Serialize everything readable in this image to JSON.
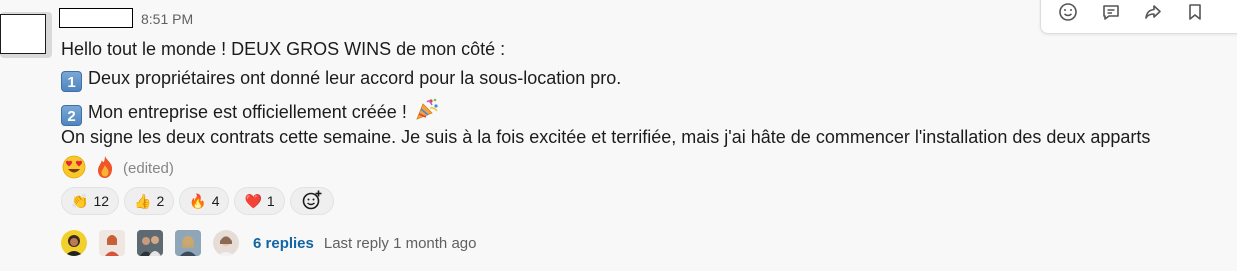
{
  "message": {
    "time": "8:51 PM",
    "lines": {
      "intro": "Hello tout le monde ! DEUX GROS WINS de mon côté :",
      "item1_num": "1",
      "item1": "Deux propriétaires ont donné leur accord pour la sous-location pro.",
      "item2_num": "2",
      "item2": "Mon entreprise est officiellement créée !",
      "body": "On signe les deux contrats cette semaine. Je suis à la fois excitée et terrifiée, mais j'ai hâte de commencer l'installation des deux apparts"
    },
    "edited": "(edited)",
    "emoji": [
      "heart-eyes",
      "fire",
      "party-popper"
    ]
  },
  "actions": {
    "icons": [
      "emoji-reaction-icon",
      "reply-thread-icon",
      "share-icon",
      "bookmark-icon"
    ]
  },
  "reactions": [
    {
      "emoji": "clap",
      "glyph": "👏",
      "count": "12"
    },
    {
      "emoji": "thumbs-up",
      "glyph": "👍",
      "count": "2"
    },
    {
      "emoji": "fire",
      "glyph": "🔥",
      "count": "4"
    },
    {
      "emoji": "heart",
      "glyph": "❤️",
      "count": "1"
    }
  ],
  "thread": {
    "replies": "6 replies",
    "last_reply": "Last reply 1 month ago"
  },
  "colors": {
    "link": "#1264a3",
    "meta": "#616061",
    "background": "#f8f8f8"
  }
}
